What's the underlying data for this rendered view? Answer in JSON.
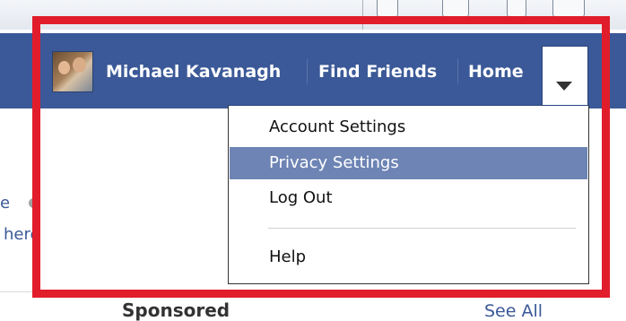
{
  "header": {
    "user_name": "Michael Kavanagh",
    "find_friends": "Find Friends",
    "home": "Home"
  },
  "menu": {
    "items": [
      {
        "label": "Account Settings",
        "active": false
      },
      {
        "label": "Privacy Settings",
        "active": true
      },
      {
        "label": "Log Out",
        "active": false
      },
      {
        "label": "Help",
        "active": false
      }
    ]
  },
  "left_snippets": {
    "line1": "e",
    "line2": "here"
  },
  "footer": {
    "sponsored": "Sponsored",
    "see_all": "See All"
  },
  "colors": {
    "facebook_blue": "#3b5998",
    "menu_highlight": "#6d84b4",
    "annotation_red": "#e11d2b"
  },
  "icons": {
    "menu_toggle": "chevron-down-icon"
  }
}
